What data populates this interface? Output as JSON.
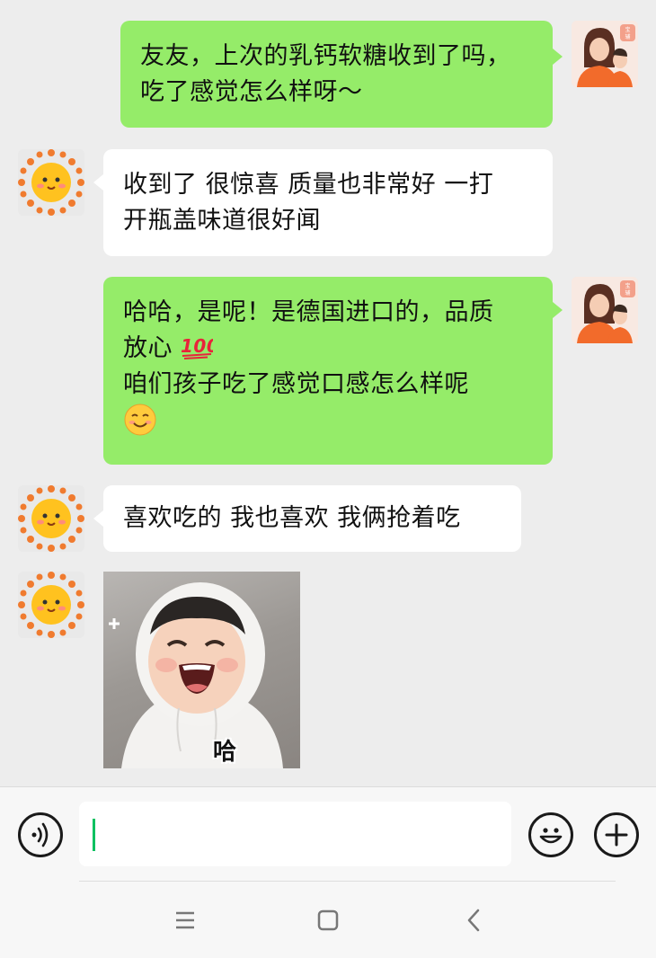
{
  "messages": [
    {
      "from": "me",
      "lines": [
        "友友，上次的乳钙软糖收到了吗，",
        "吃了感觉怎么样呀～"
      ]
    },
    {
      "from": "other",
      "lines": [
        "收到了 很惊喜 质量也非常好 一打",
        "开瓶盖味道很好闻"
      ]
    },
    {
      "from": "me",
      "lines": [
        "哈哈，是呢！是德国进口的，品质",
        "放心",
        "咱们孩子吃了感觉口感怎么样呢"
      ],
      "emoji": [
        "hundred-points-emoji",
        "smiling-face-emoji"
      ]
    },
    {
      "from": "other",
      "lines": [
        "喜欢吃的 我也喜欢 我俩抢着吃"
      ]
    },
    {
      "from": "other",
      "type": "sticker",
      "caption": "哈"
    }
  ],
  "avatar_badge": "宝\n辅",
  "colors": {
    "my_bubble": "#95ec69",
    "other_bubble": "#ffffff",
    "background": "#ededed",
    "caret": "#07c160"
  },
  "input_bar": {
    "value": "",
    "icons": [
      "voice-icon",
      "emoji-icon",
      "plus-icon"
    ]
  },
  "system_nav": {
    "icons": [
      "menu-icon",
      "home-icon",
      "back-icon"
    ]
  }
}
